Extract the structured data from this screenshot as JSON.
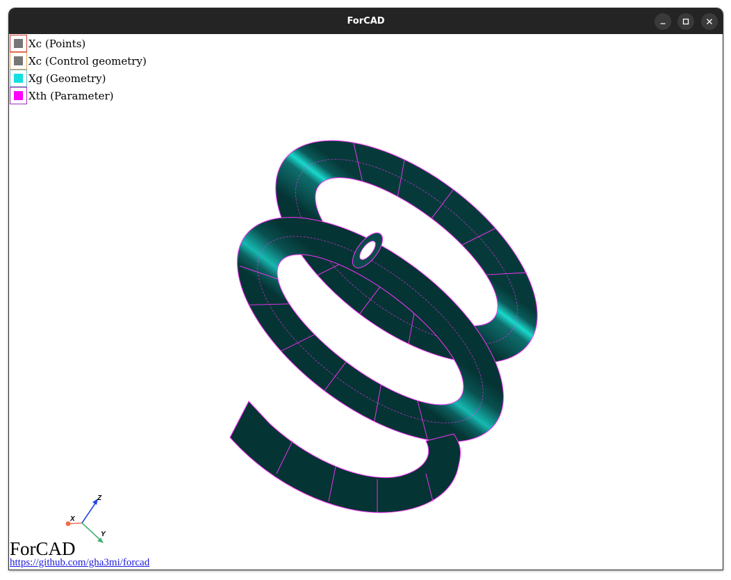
{
  "window": {
    "title": "ForCAD",
    "controls": {
      "minimize": "minimize",
      "maximize": "maximize",
      "close": "close"
    }
  },
  "legend": [
    {
      "label": "Xc (Points)",
      "swatch": "#777777",
      "border": "#d43a3a"
    },
    {
      "label": "Xc (Control geometry)",
      "swatch": "#777777",
      "border": "#e3a35a"
    },
    {
      "label": "Xg (Geometry)",
      "swatch": "#14e0e0",
      "border": "#6cb6c7"
    },
    {
      "label": "Xth (Parameter)",
      "swatch": "#ff00ff",
      "border": "#9b30b8"
    }
  ],
  "axes": {
    "x": "X",
    "y": "Y",
    "z": "Z"
  },
  "colors": {
    "surface": "#0a5455",
    "mesh": "#ff33ff",
    "titlebar": "#242424"
  },
  "brand": "ForCAD",
  "url": "https://github.com/gha3mi/forcad"
}
